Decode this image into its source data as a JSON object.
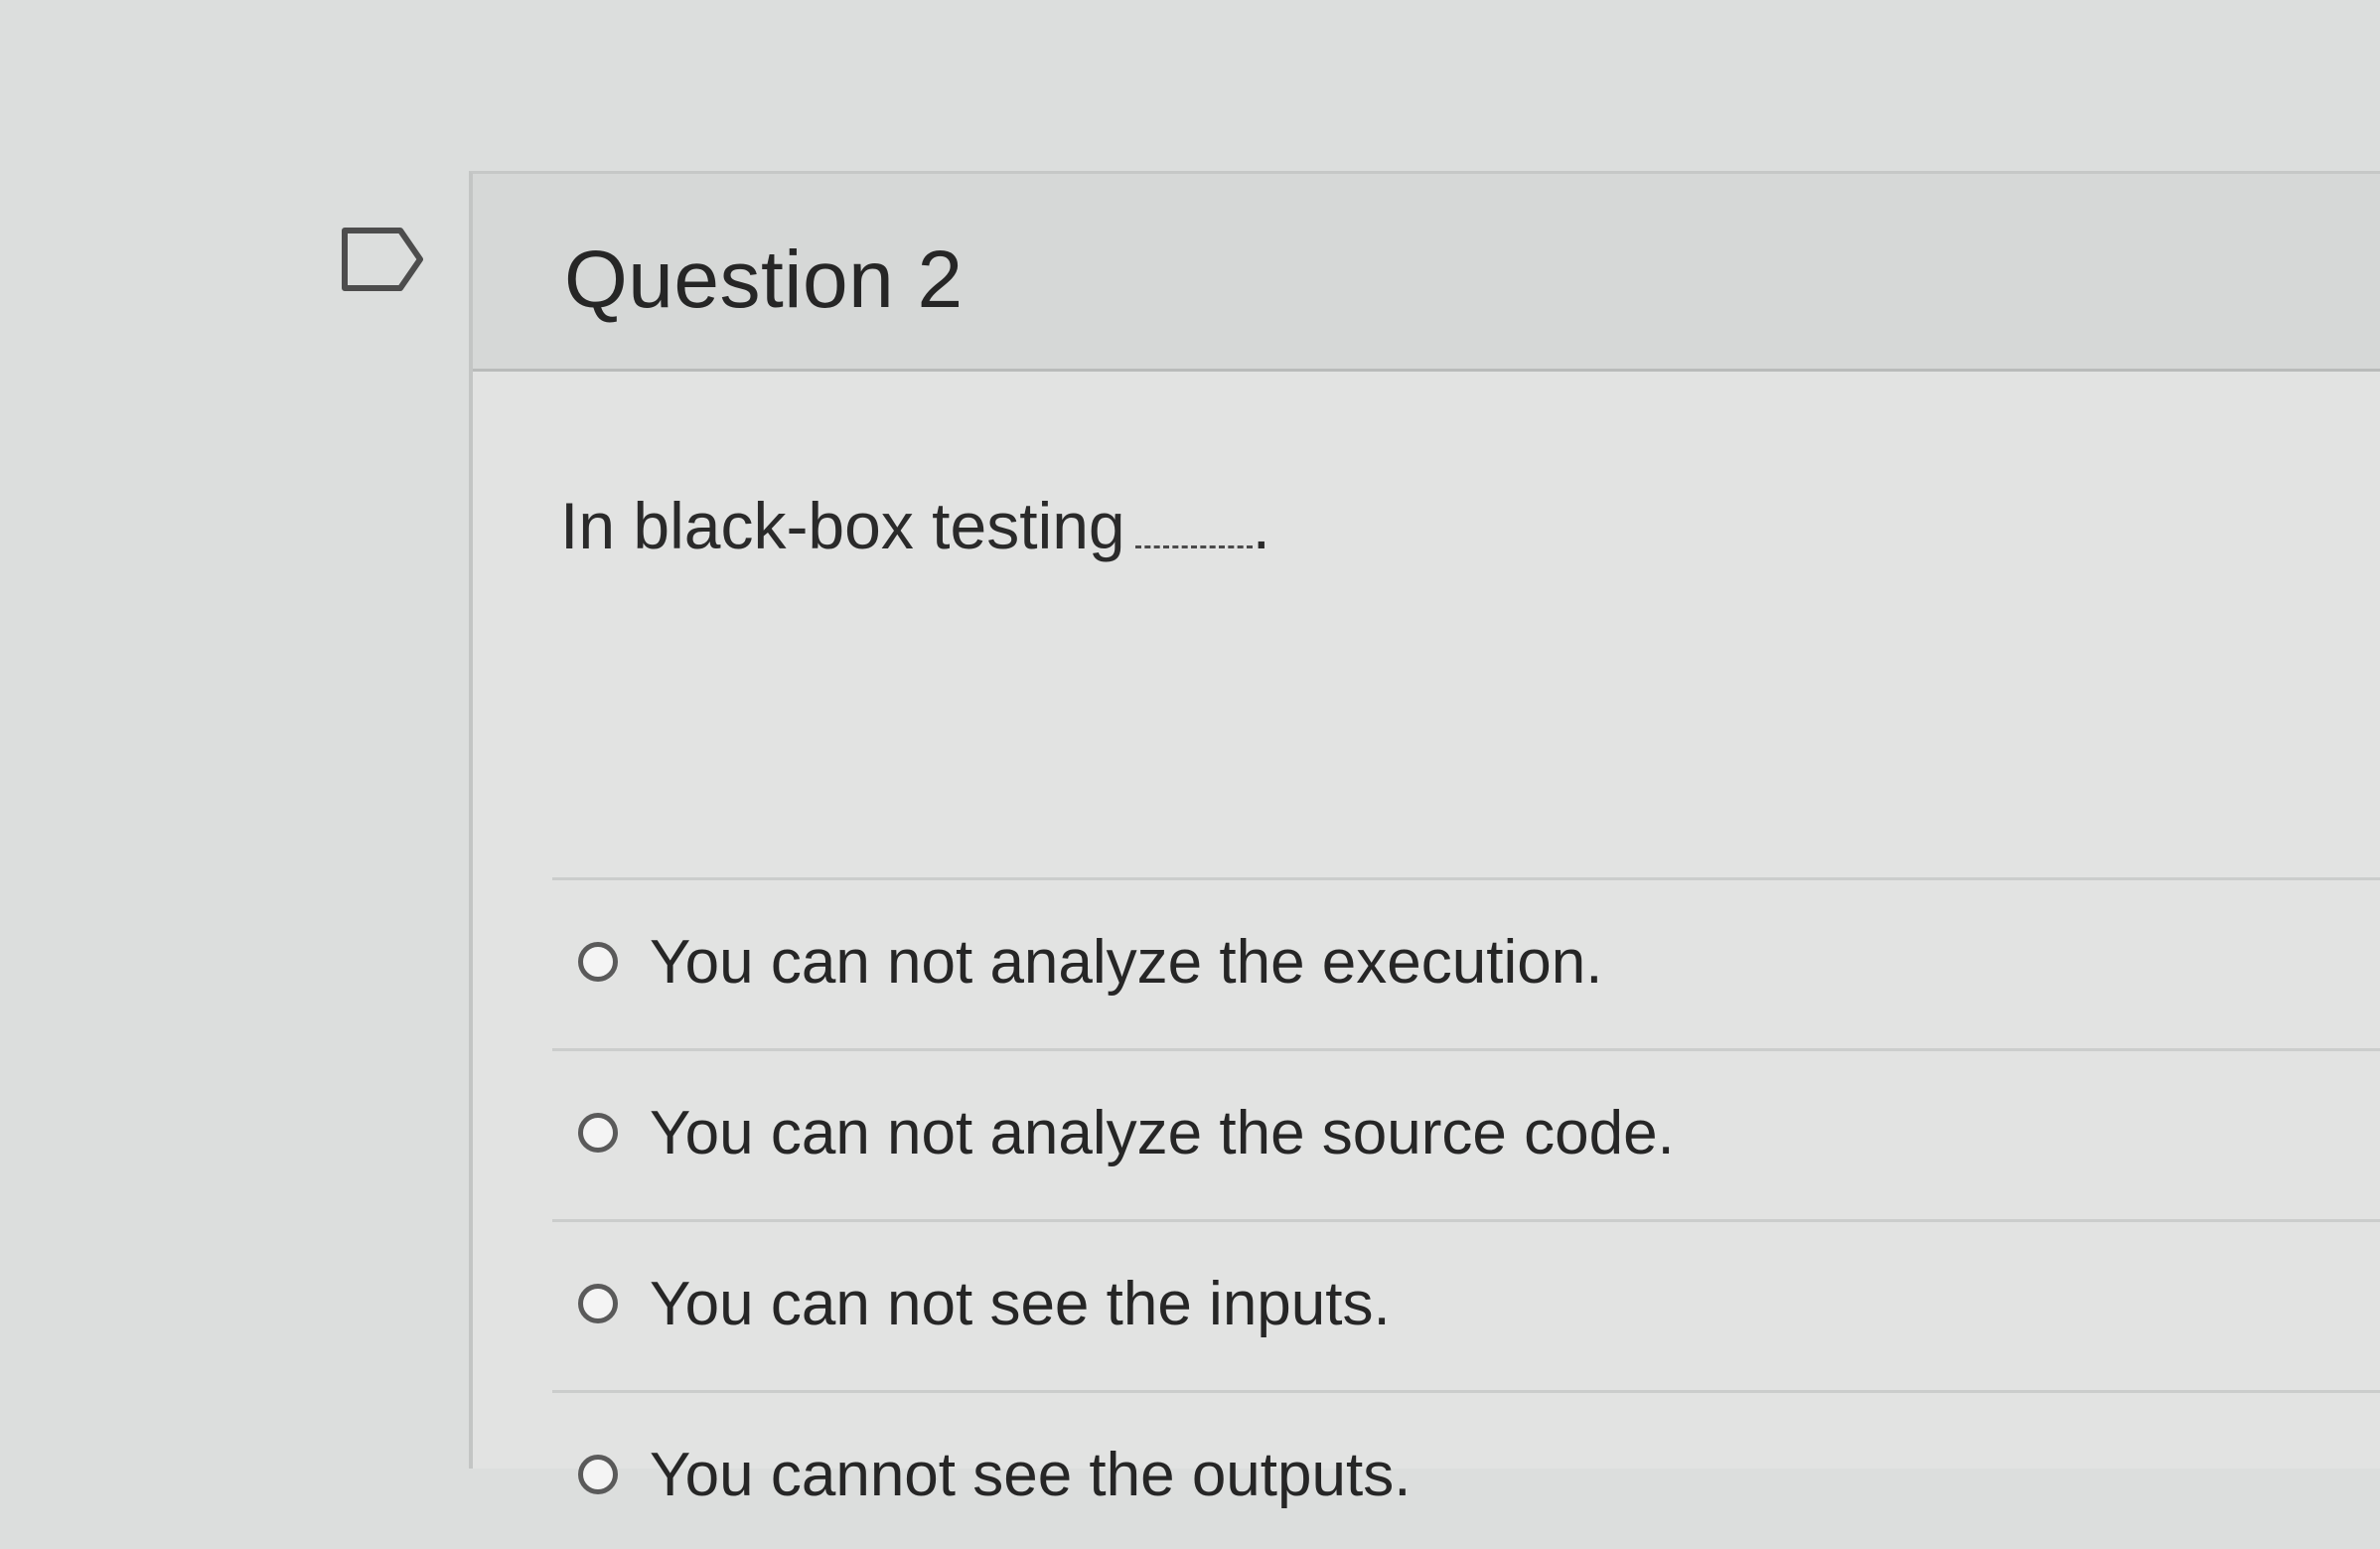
{
  "question": {
    "title": "Question 2",
    "text": "In black-box testing",
    "text_end": ".",
    "answers": [
      {
        "label": "You can not analyze the execution.",
        "selected": false
      },
      {
        "label": "You can not analyze the source code.",
        "selected": false
      },
      {
        "label": "You can not see the inputs.",
        "selected": false
      },
      {
        "label": "You cannot see the outputs.",
        "selected": false
      }
    ]
  },
  "icons": {
    "bookmark": "bookmark-flag-icon",
    "radio": "radio-button-icon"
  },
  "colors": {
    "background": "#dcdedd",
    "header": "#d6d8d7",
    "text": "#262626"
  }
}
